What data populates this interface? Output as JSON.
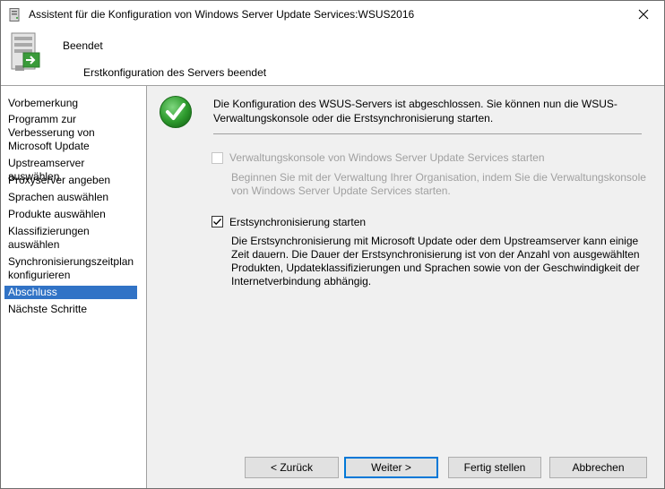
{
  "window": {
    "title": "Assistent für die Konfiguration von Windows Server Update Services:WSUS2016"
  },
  "header": {
    "title": "Beendet",
    "subtitle": "Erstkonfiguration des Servers beendet"
  },
  "nav": {
    "items": [
      {
        "label": "Vorbemerkung",
        "active": false
      },
      {
        "label": "Programm zur Verbesserung von Microsoft Update",
        "active": false
      },
      {
        "label": "Upstreamserver auswählen",
        "active": false
      },
      {
        "label": "Proxyserver angeben",
        "active": false
      },
      {
        "label": "Sprachen auswählen",
        "active": false
      },
      {
        "label": "Produkte auswählen",
        "active": false
      },
      {
        "label": "Klassifizierungen auswählen",
        "active": false
      },
      {
        "label": "Synchronisierungszeitplan konfigurieren",
        "active": false
      },
      {
        "label": "Abschluss",
        "active": true
      },
      {
        "label": "Nächste Schritte",
        "active": false
      }
    ]
  },
  "main": {
    "intro": "Die Konfiguration des WSUS-Servers ist abgeschlossen. Sie können nun die WSUS-Verwaltungskonsole oder die Erstsynchronisierung starten.",
    "option_console": {
      "label": "Verwaltungskonsole von Windows Server Update Services starten",
      "checked": false,
      "enabled": false,
      "description": "Beginnen Sie mit der Verwaltung Ihrer Organisation, indem Sie die Verwaltungskonsole von Windows Server Update Services starten."
    },
    "option_sync": {
      "label": "Erstsynchronisierung starten",
      "checked": true,
      "enabled": true,
      "description": "Die Erstsynchronisierung mit Microsoft Update oder dem Upstreamserver kann einige Zeit dauern. Die Dauer der Erstsynchronisierung ist von der Anzahl von ausgewählten Produkten, Updateklassifizierungen und Sprachen sowie von der Geschwindigkeit der Internetverbindung abhängig."
    }
  },
  "buttons": {
    "back": "< Zurück",
    "next": "Weiter >",
    "finish": "Fertig stellen",
    "cancel": "Abbrechen"
  },
  "colors": {
    "accent": "#3173c6",
    "default_button_border": "#0078d7",
    "success_green": "#2e9b2e"
  },
  "icons": {
    "title": "server-icon",
    "header": "server-update-icon",
    "status": "success-check-icon",
    "close": "close-icon"
  }
}
